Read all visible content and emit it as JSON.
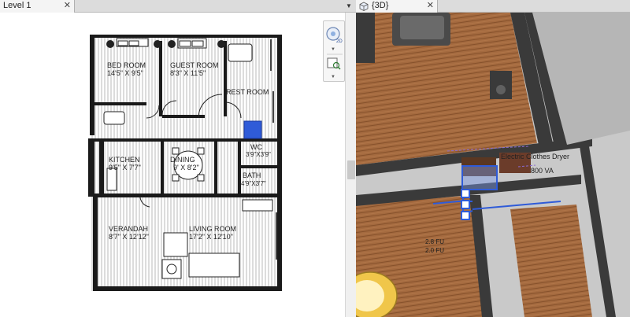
{
  "left_view": {
    "tab_title": "Level 1",
    "close_glyph": "✕"
  },
  "right_view": {
    "tab_title": "{3D}",
    "close_glyph": "✕",
    "dryer_label": "Electric Clothes Dryer",
    "tag_lines": [
      "2.8 FU",
      "2.0 FU"
    ],
    "va_label": "800 VA"
  },
  "floor_plan": {
    "rooms": [
      {
        "name": "BED ROOM",
        "size": "14'5\" X 9'5\""
      },
      {
        "name": "GUEST ROOM",
        "size": "8'3\" X 11'5\""
      },
      {
        "name": "REST ROOM",
        "size": ""
      },
      {
        "name": "WC",
        "size": "3'9\"X3'9\""
      },
      {
        "name": "KITCHEN",
        "size": "9'5\" X 7'7\""
      },
      {
        "name": "DINING",
        "size": "9' X 8'2\""
      },
      {
        "name": "BATH",
        "size": "4'9\"X3'7\""
      },
      {
        "name": "VERANDAH",
        "size": "8'7\" X 12'12\""
      },
      {
        "name": "LIVING ROOM",
        "size": "17'2\" X 12'10\""
      }
    ]
  },
  "icons": {
    "cube": "cube-icon",
    "steering_wheel": "steering-wheel-icon",
    "zoom": "zoom-region-icon"
  },
  "colors": {
    "wall": "#1a1a1a",
    "floor_wood": "#a46a3f",
    "wall_3d": "#3a3a3a",
    "selection": "#2f5bd8"
  }
}
